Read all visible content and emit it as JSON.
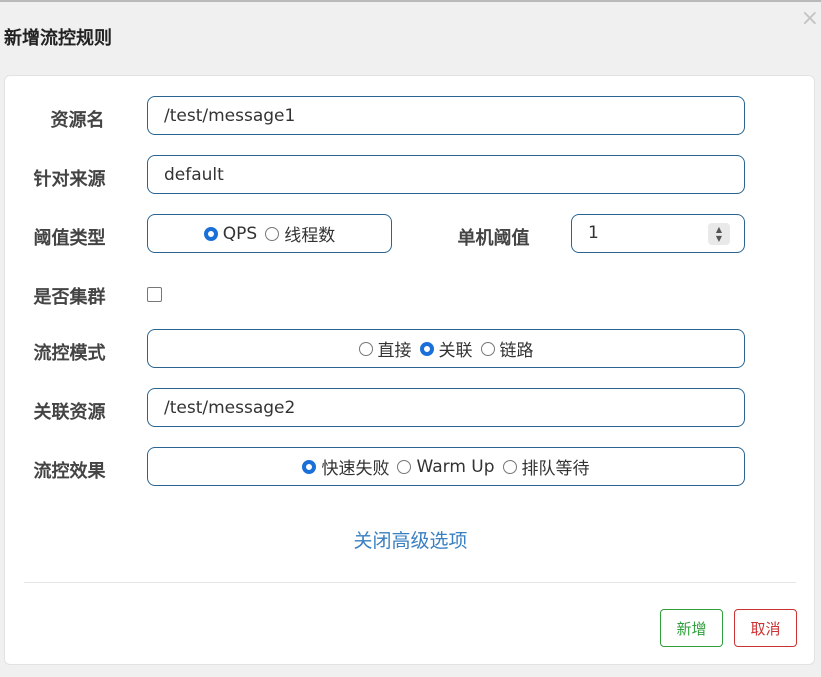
{
  "dialog": {
    "title": "新增流控规则",
    "close_glyph": "×"
  },
  "form": {
    "resource_name": {
      "label": "资源名",
      "value": "/test/message1"
    },
    "limit_origin": {
      "label": "针对来源",
      "value": "default"
    },
    "threshold_type": {
      "label": "阈值类型",
      "options": [
        "QPS",
        "线程数"
      ],
      "selected": "QPS"
    },
    "single_threshold": {
      "label": "单机阈值",
      "value": "1"
    },
    "cluster_mode": {
      "label": "是否集群",
      "checked": false
    },
    "control_mode": {
      "label": "流控模式",
      "options": [
        "直接",
        "关联",
        "链路"
      ],
      "selected": "关联"
    },
    "ref_resource": {
      "label": "关联资源",
      "value": "/test/message2"
    },
    "control_effect": {
      "label": "流控效果",
      "options": [
        "快速失败",
        "Warm Up",
        "排队等待"
      ],
      "selected": "快速失败"
    }
  },
  "advanced_toggle": "关闭高级选项",
  "buttons": {
    "add": "新增",
    "cancel": "取消"
  },
  "colors": {
    "input_border": "#2a6491",
    "radio_checked": "#1a6fd8",
    "link": "#3a7fc1",
    "add_button": "#2f9f3c",
    "cancel_button": "#cc3333"
  },
  "icons": {
    "close": "close-icon",
    "spinner": "number-spinner-icon"
  }
}
